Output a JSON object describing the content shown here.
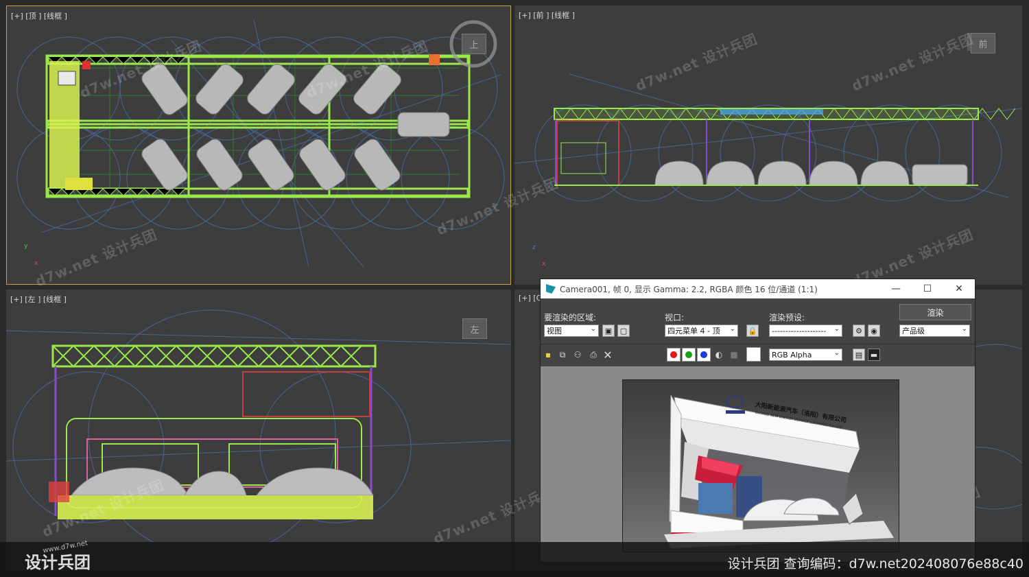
{
  "viewports": {
    "top": {
      "label": "[+] [顶 ] [线框 ]",
      "cube": "上"
    },
    "front": {
      "label": "[+] [前 ] [线框 ]",
      "cube": "前"
    },
    "left": {
      "label": "[+] [左 ] [线框 ]",
      "cube": "左"
    },
    "persp": {
      "label": "[+] [C"
    }
  },
  "axes": {
    "y": "y",
    "x": "x",
    "z": "z"
  },
  "watermark": {
    "text": "d7w.net 设计兵团"
  },
  "render_window": {
    "title": "Camera001, 帧 0, 显示 Gamma: 2.2, RGBA 颜色 16 位/通道 (1:1)",
    "minimize": "—",
    "maximize": "☐",
    "close": "✕",
    "area_label": "要渲染的区域:",
    "area_value": "视图",
    "viewport_label": "视口:",
    "viewport_value": "四元菜单 4 - 顶",
    "preset_label": "渲染预设:",
    "preset_value": "--------------------",
    "render_button": "渲染",
    "quality_value": "产品级",
    "channel_value": "RGB Alpha",
    "booth_company_cn": "大阳新能源汽车（洛阳）有限公司",
    "booth_company_en": "DAYANG NEW ENERGY VEHICLE (LUOYANG) CO.,LTD."
  },
  "bottom": {
    "logo": "设计兵团",
    "logo_url": "www.d7w.net",
    "query_text": "设计兵团  查询编码：d7w.net202408076e88c40"
  },
  "colors": {
    "truss": "#9be84a",
    "grid": "#4a6fa8",
    "accent": "#e0b020"
  }
}
